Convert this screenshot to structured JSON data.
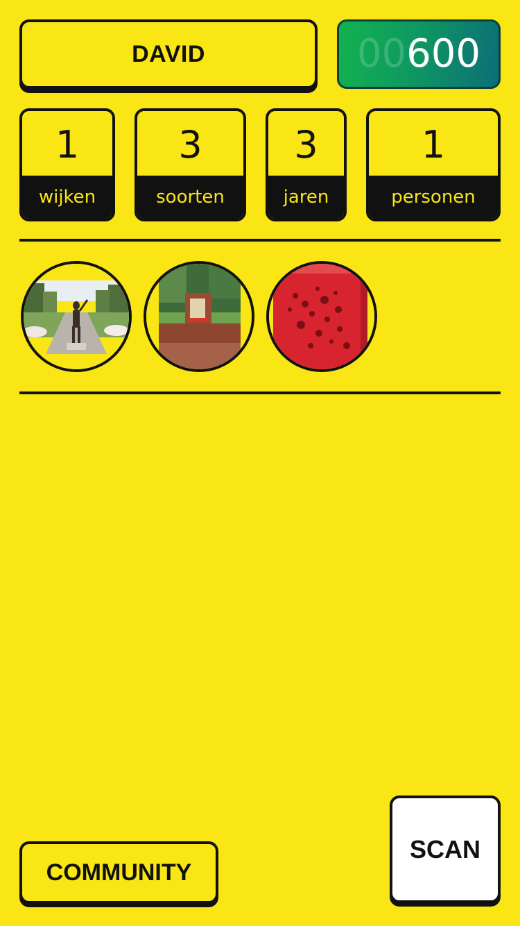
{
  "header": {
    "user_name": "DAVID",
    "score_padding": "00",
    "score_value": "600"
  },
  "stats": [
    {
      "value": "1",
      "label": "wijken"
    },
    {
      "value": "3",
      "label": "soorten"
    },
    {
      "value": "3",
      "label": "jaren"
    },
    {
      "value": "1",
      "label": "personen"
    }
  ],
  "photos": [
    {
      "subject": "statue-in-rose-garden"
    },
    {
      "subject": "brick-memorial-monument"
    },
    {
      "subject": "red-perforated-box-artwork"
    }
  ],
  "footer": {
    "community_label": "COMMUNITY",
    "scan_label": "SCAN"
  },
  "colors": {
    "background": "#F9E614",
    "ink": "#111111",
    "score_gradient_start": "#13B24F",
    "score_gradient_end": "#0D6E78"
  }
}
